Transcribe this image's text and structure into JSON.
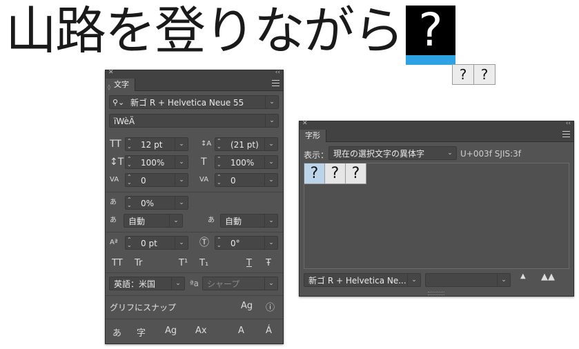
{
  "headline": {
    "text": "山路を登りながら",
    "selected_glyph": "?"
  },
  "mini_alternates": [
    "?",
    "?"
  ],
  "character_panel": {
    "tab": "文字",
    "font_family": "新ゴ R + Helvetica Neue 55",
    "font_style": "ïWèÄ",
    "size": "12 pt",
    "leading": "(21 pt)",
    "vertical_scale": "100%",
    "horizontal_scale": "100%",
    "kerning": "0",
    "tracking": "0",
    "tsume": "0%",
    "aki_left": "自動",
    "aki_right": "自動",
    "baseline_shift": "0 pt",
    "rotation": "0°",
    "style_buttons": [
      "TT",
      "Tr",
      "T¹",
      "T₁",
      "T",
      "Ŧ"
    ],
    "language": "英語：米国",
    "aa_prefix": "ªa",
    "antialias": "シャープ",
    "snap_label": "グリフにスナップ",
    "snap_buttons": [
      "あ",
      "字",
      "Ag",
      "Ax",
      "A",
      "Á"
    ]
  },
  "glyphs_panel": {
    "tab": "字形",
    "show_label": "表示：",
    "show_value": "現在の選択文字の異体字",
    "unicode_info": "U+003f SJIS:3f",
    "glyphs": [
      "?",
      "?",
      "?"
    ],
    "font": "新ゴ R + Helvetica Ne...",
    "style": ""
  }
}
